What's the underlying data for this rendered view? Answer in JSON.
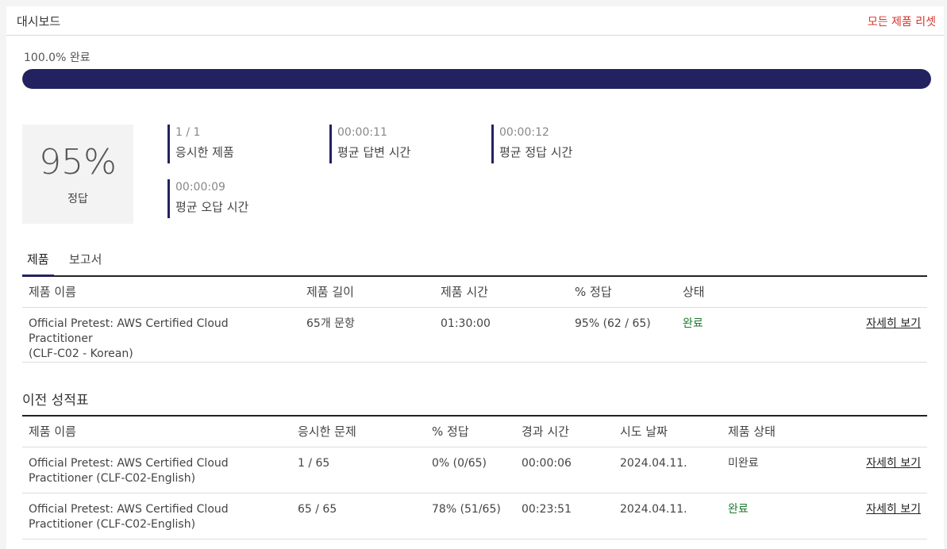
{
  "header": {
    "title": "대시보드",
    "reset_label": "모든 제품 리셋"
  },
  "progress": {
    "label": "100.0% 완료",
    "value_percent": 100
  },
  "score": {
    "percent": "95%",
    "label": "정답"
  },
  "stats": [
    {
      "value": "1 / 1",
      "label": "응시한 제품"
    },
    {
      "value": "00:00:11",
      "label": "평균 답변 시간"
    },
    {
      "value": "00:00:12",
      "label": "평균 정답 시간"
    },
    {
      "value": "00:00:09",
      "label": "평균 오답 시간"
    }
  ],
  "tabs": [
    {
      "label": "제품"
    },
    {
      "label": "보고서"
    }
  ],
  "products_table": {
    "headers": [
      "제품 이름",
      "제품 길이",
      "제품 시간",
      "% 정답",
      "상태"
    ],
    "rows": [
      {
        "name_line1": "Official Pretest: AWS Certified Cloud Practitioner",
        "name_line2": "(CLF-C02 - Korean)",
        "length": "65개 문항",
        "time": "01:30:00",
        "correct": "95% (62 / 65)",
        "status": "완료",
        "link": "자세히 보기"
      }
    ]
  },
  "history": {
    "title": "이전 성적표",
    "headers": [
      "제품 이름",
      "응시한 문제",
      "% 정답",
      "경과 시간",
      "시도 날짜",
      "제품 상태"
    ],
    "rows": [
      {
        "name_line1": "Official Pretest: AWS Certified Cloud",
        "name_line2": "Practitioner (CLF-C02-English)",
        "answered": "1 / 65",
        "correct": "0% (0/65)",
        "elapsed": "00:00:06",
        "date": "2024.04.11.",
        "status": "미완료",
        "link": "자세히 보기"
      },
      {
        "name_line1": "Official Pretest: AWS Certified Cloud",
        "name_line2": "Practitioner (CLF-C02-English)",
        "answered": "65 / 65",
        "correct": "78% (51/65)",
        "elapsed": "00:23:51",
        "date": "2024.04.11.",
        "status": "완료",
        "link": "자세히 보기"
      }
    ]
  },
  "colors": {
    "accent": "#232260",
    "reset": "#d9342b",
    "complete": "#1e7a2e"
  }
}
